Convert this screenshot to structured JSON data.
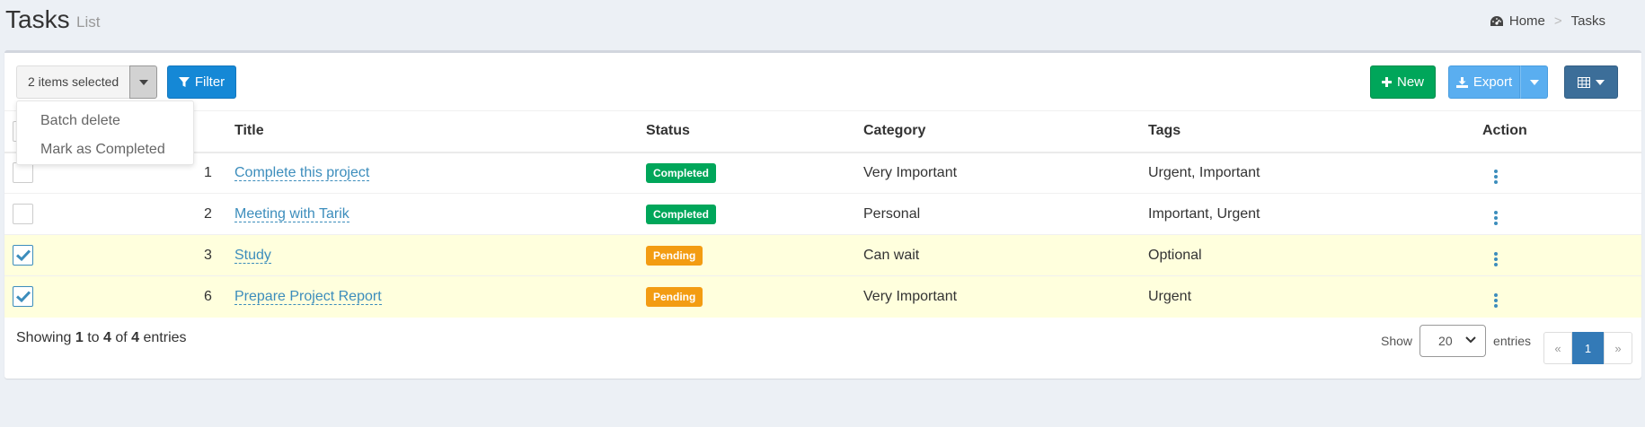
{
  "header": {
    "title": "Tasks",
    "subtitle": "List"
  },
  "breadcrumb": {
    "home": "Home",
    "separator": ">",
    "current": "Tasks"
  },
  "toolbar": {
    "selected_label": "2 items selected",
    "filter_label": "Filter",
    "new_label": "New",
    "export_label": "Export"
  },
  "batch_menu": {
    "items": [
      "Batch delete",
      "Mark as Completed"
    ]
  },
  "table": {
    "headers": {
      "title": "Title",
      "status": "Status",
      "category": "Category",
      "tags": "Tags",
      "action": "Action"
    },
    "rows": [
      {
        "id": "1",
        "title": "Complete this project",
        "status": "Completed",
        "category": "Very Important",
        "tags": "Urgent, Important",
        "checked": false
      },
      {
        "id": "2",
        "title": "Meeting with Tarik",
        "status": "Completed",
        "category": "Personal",
        "tags": "Important, Urgent",
        "checked": false
      },
      {
        "id": "3",
        "title": "Study",
        "status": "Pending",
        "category": "Can wait",
        "tags": "Optional",
        "checked": true
      },
      {
        "id": "6",
        "title": "Prepare Project Report",
        "status": "Pending",
        "category": "Very Important",
        "tags": "Urgent",
        "checked": true
      }
    ]
  },
  "footer": {
    "showing": "Showing",
    "from": "1",
    "to_word": "to",
    "to": "4",
    "of_word": "of",
    "total": "4",
    "entries_word": "entries",
    "show_label": "Show",
    "per_page": "20",
    "entries_label": "entries",
    "pager": {
      "prev": "«",
      "page": "1",
      "next": "»"
    }
  },
  "colors": {
    "primary": "#3c8dbc",
    "success": "#00a65a",
    "warning": "#f39c12",
    "filter": "#1588d6",
    "selected_row": "#ffffdd"
  }
}
